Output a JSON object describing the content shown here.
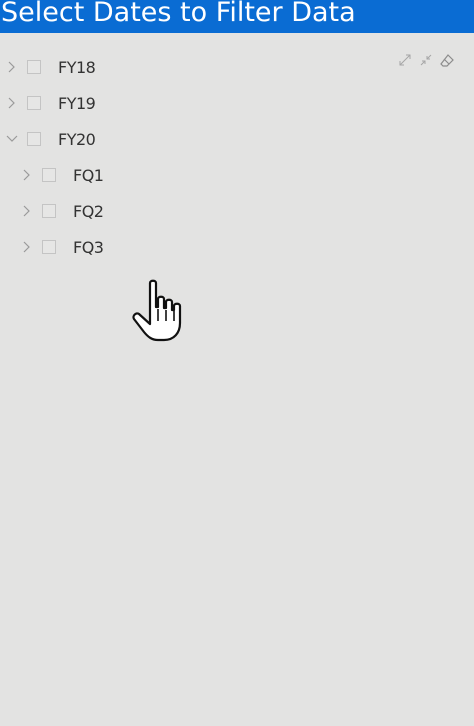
{
  "header": {
    "title": "Select Dates to Filter Data"
  },
  "toolbar": {
    "icons": [
      "expand-icon",
      "collapse-icon",
      "eraser-icon"
    ]
  },
  "tree": {
    "nodes": [
      {
        "label": "FY18",
        "expanded": false,
        "level": 0,
        "checked": false
      },
      {
        "label": "FY19",
        "expanded": false,
        "level": 0,
        "checked": false
      },
      {
        "label": "FY20",
        "expanded": true,
        "level": 0,
        "checked": false
      },
      {
        "label": "FQ1",
        "expanded": false,
        "level": 1,
        "checked": false
      },
      {
        "label": "FQ2",
        "expanded": false,
        "level": 1,
        "checked": false
      },
      {
        "label": "FQ3",
        "expanded": false,
        "level": 1,
        "checked": false
      }
    ]
  },
  "colors": {
    "header_bg": "#0a6cd3",
    "panel_bg": "#e3e3e2",
    "text": "#333333"
  }
}
